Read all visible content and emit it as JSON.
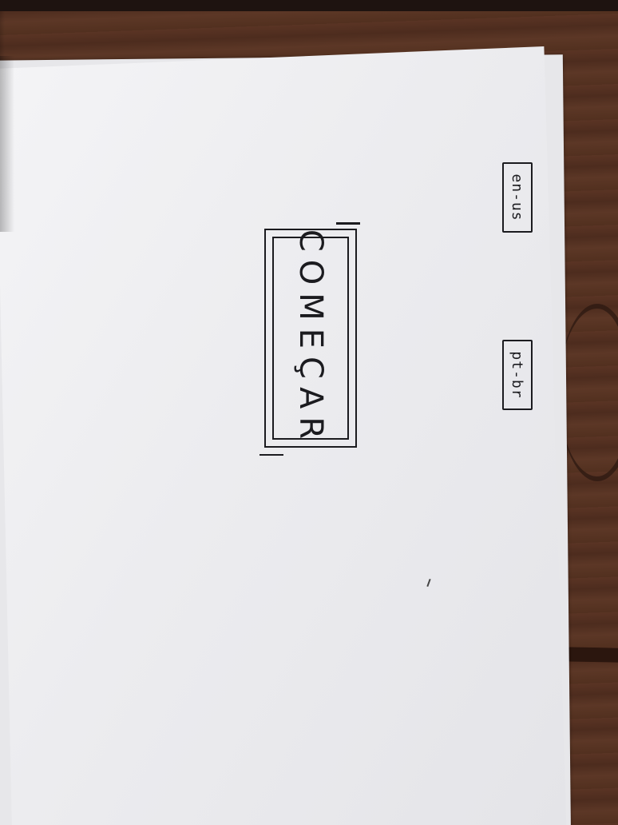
{
  "sketch": {
    "language_options": [
      "en-us",
      "pt-br"
    ],
    "start_button_label": "COMEÇAR"
  },
  "colors": {
    "ink": "#1b1b1f",
    "paper": "#ececef",
    "table": "#4d2c1e"
  }
}
